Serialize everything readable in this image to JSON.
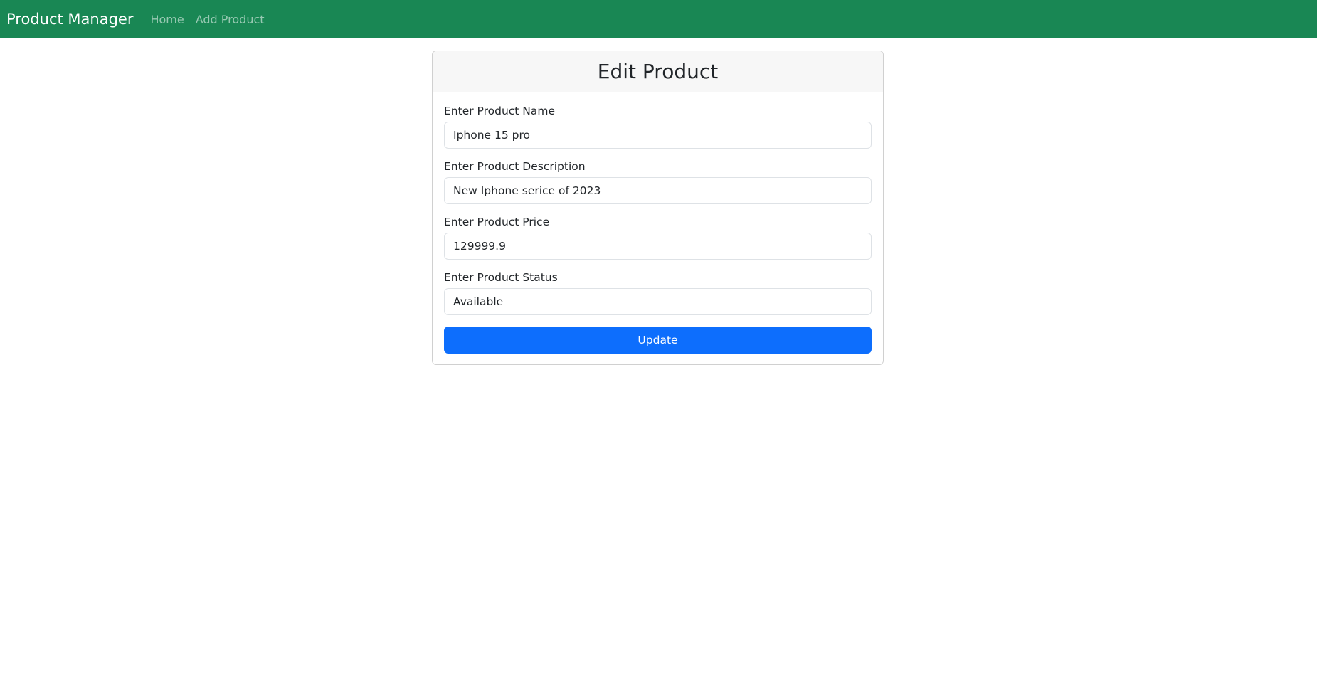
{
  "navbar": {
    "brand": "Product Manager",
    "links": [
      "Home",
      "Add Product"
    ],
    "color": "#198754"
  },
  "form": {
    "title": "Edit Product",
    "fields": [
      {
        "label": "Enter Product Name",
        "value": "Iphone 15 pro"
      },
      {
        "label": "Enter Product Description",
        "value": "New Iphone serice of 2023"
      },
      {
        "label": "Enter Product Price",
        "value": "129999.9"
      },
      {
        "label": "Enter Product Status",
        "value": "Available"
      }
    ],
    "submit_label": "Update",
    "button_color": "#0d6efd"
  }
}
